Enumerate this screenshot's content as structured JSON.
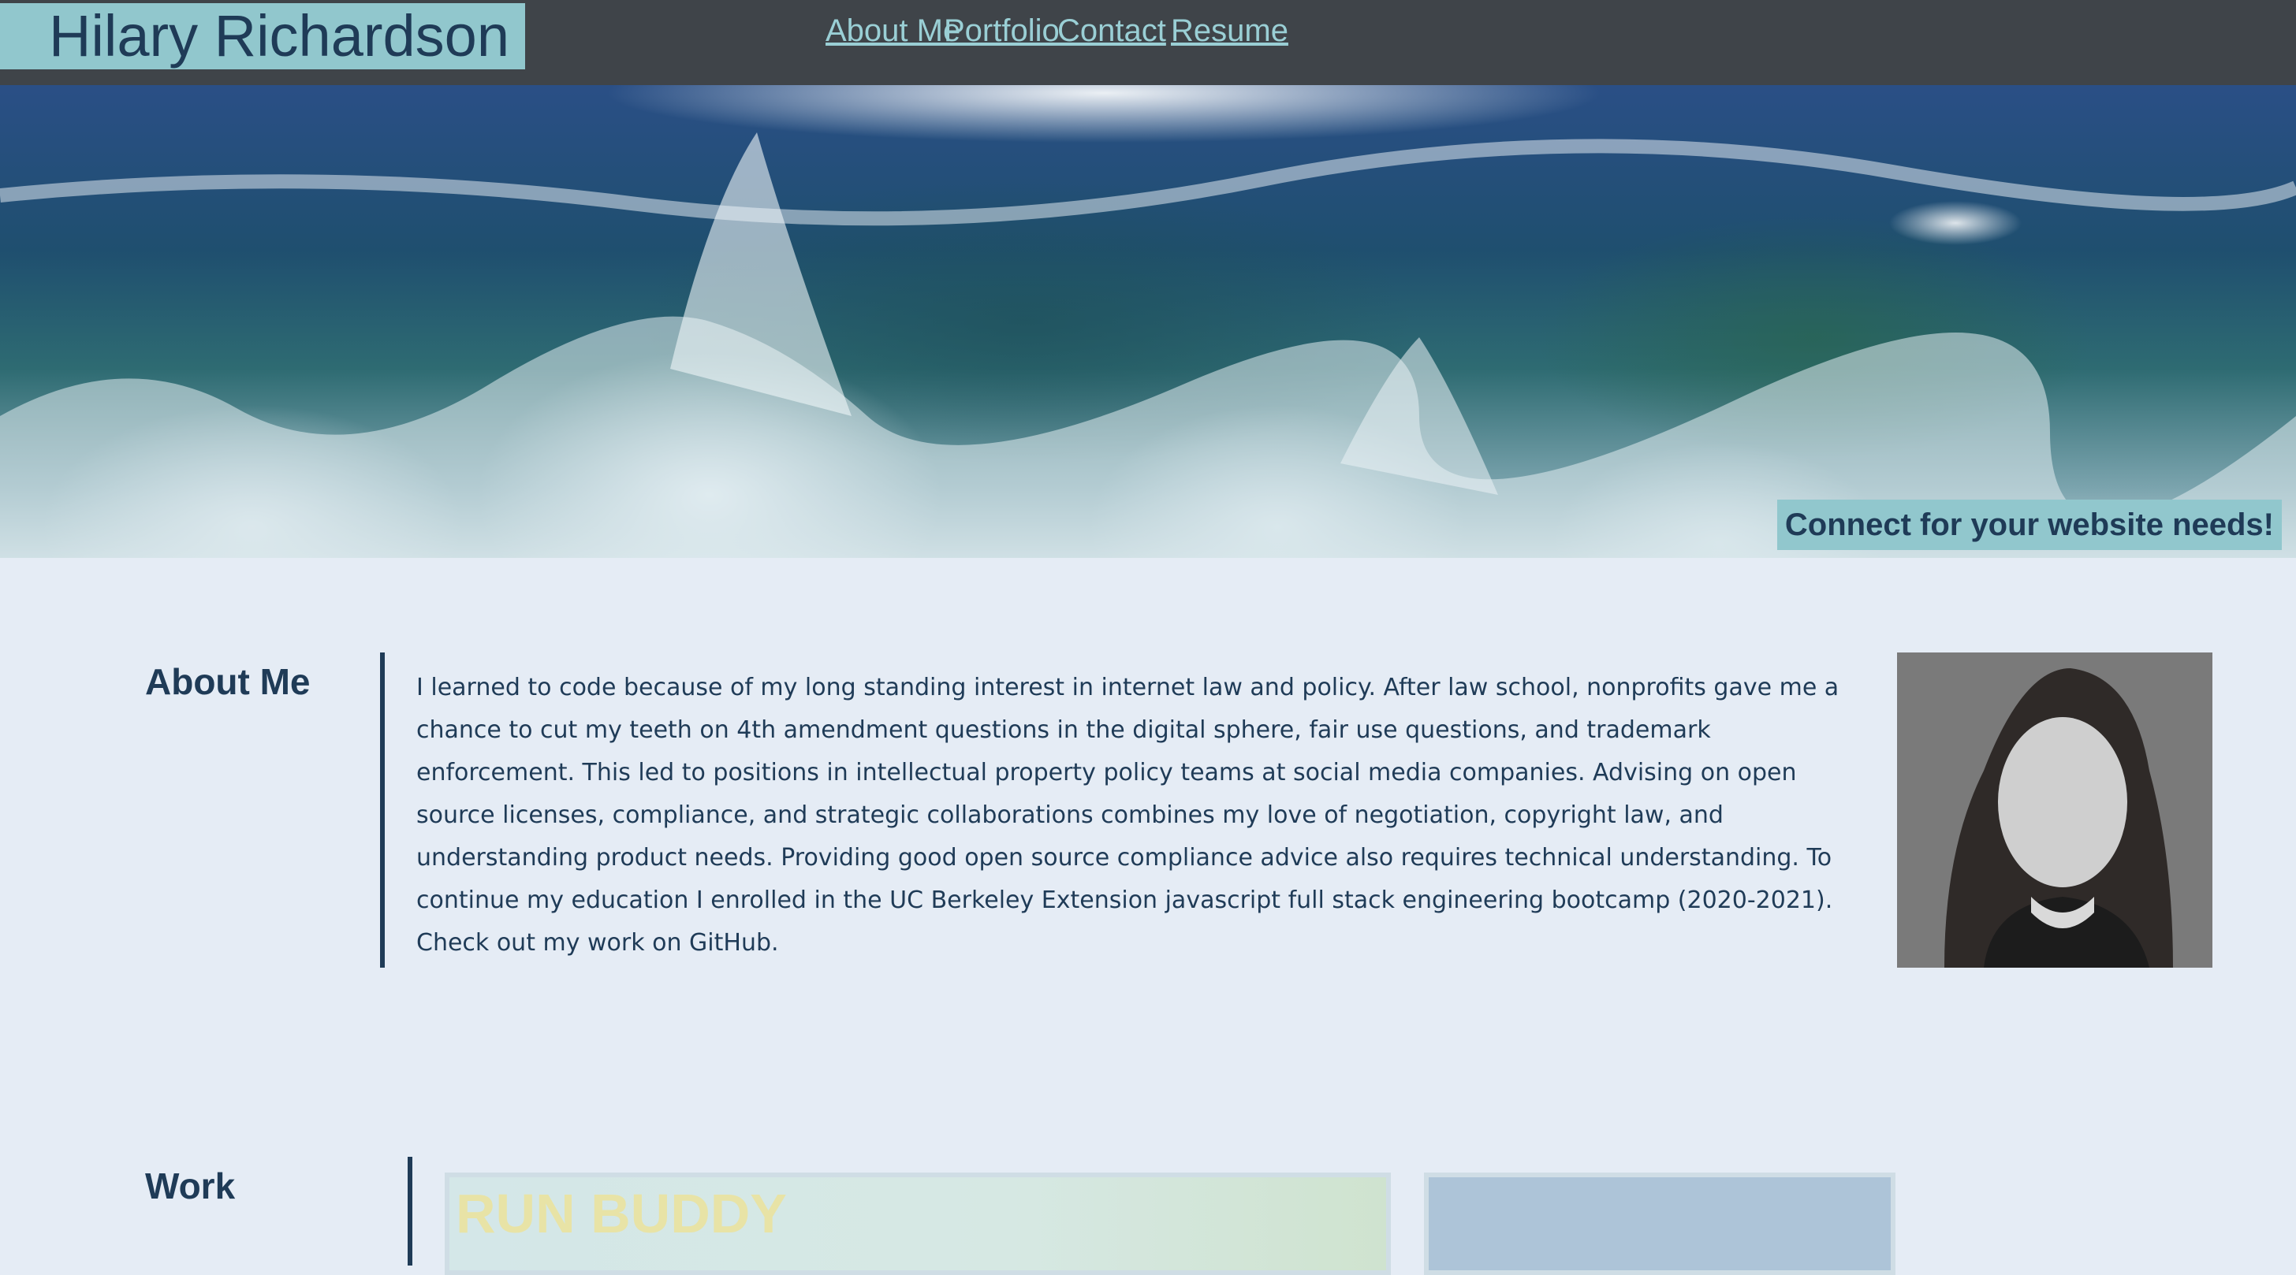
{
  "header": {
    "title": "Hilary Richardson",
    "nav": [
      "About Me",
      "Portfolio",
      "Contact",
      "Resume"
    ]
  },
  "hero": {
    "cta": "Connect for your website needs!"
  },
  "about": {
    "heading": "About Me",
    "text": "I learned to code because of my long standing interest in internet law and policy. After law school, nonprofits gave me a chance to cut my teeth on 4th amendment questions in the digital sphere, fair use questions, and trademark enforcement. This led to positions in intellectual property policy teams at social media companies. Advising on open source licenses, compliance, and strategic collaborations combines my love of negotiation, copyright law, and understanding product needs. Providing good open source compliance advice also requires technical understanding. To continue my education I enrolled in the UC Berkeley Extension javascript full stack engineering bootcamp (2020-2021). Check out my work on GitHub."
  },
  "work": {
    "heading": "Work",
    "projects": [
      {
        "title": "RUN BUDDY"
      }
    ]
  },
  "colors": {
    "header_bg": "#3f4449",
    "accent": "#91c7cd",
    "nav_link": "#9acfd5",
    "text": "#1f3b57",
    "page_bg": "#e5ecf5"
  }
}
